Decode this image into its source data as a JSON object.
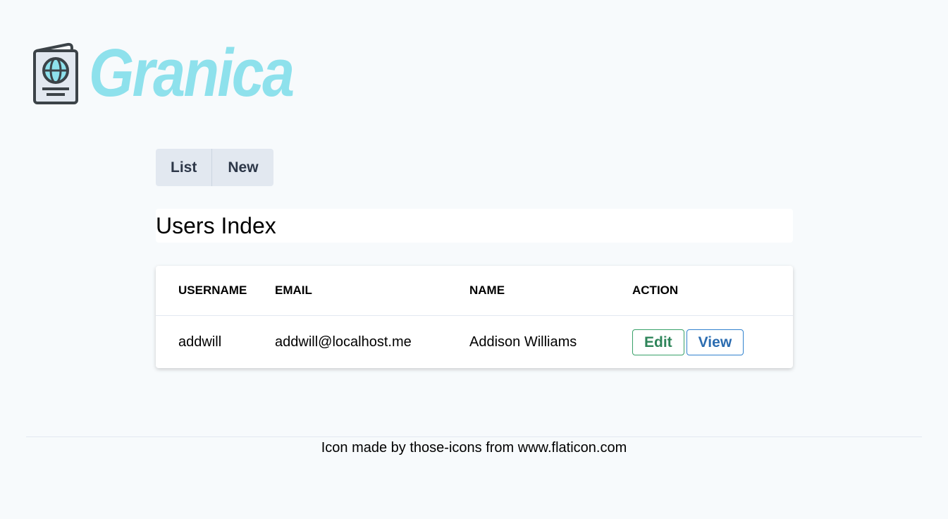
{
  "brand": {
    "name": "Granica",
    "icon": "passport-icon",
    "color": "#8ee1ec"
  },
  "nav": {
    "items": [
      {
        "label": "List"
      },
      {
        "label": "New"
      }
    ]
  },
  "page": {
    "title": "Users Index"
  },
  "table": {
    "headers": [
      "USERNAME",
      "EMAIL",
      "NAME",
      "ACTION"
    ],
    "rows": [
      {
        "username": "addwill",
        "email": "addwill@localhost.me",
        "name": "Addison Williams",
        "edit_label": "Edit",
        "view_label": "View"
      }
    ]
  },
  "footer": {
    "text": "Icon made by those-icons from www.flaticon.com"
  },
  "colors": {
    "edit": "#2f855a",
    "view": "#2b6cb0",
    "background": "#f7fafc"
  }
}
